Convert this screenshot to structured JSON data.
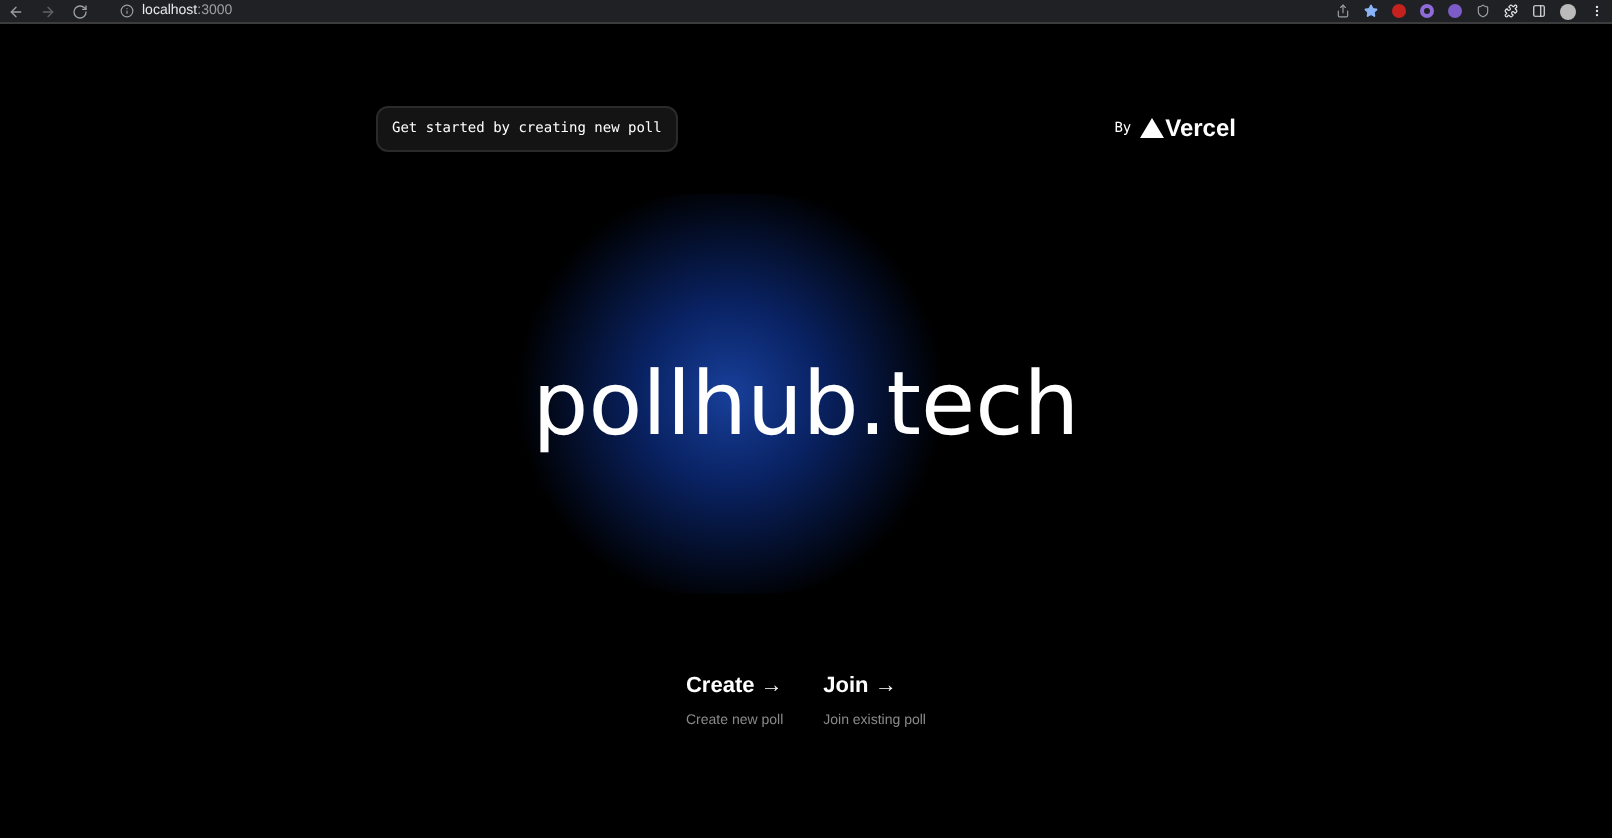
{
  "browser": {
    "host": "localhost",
    "port": ":3000"
  },
  "description": "Get started by creating new poll",
  "by": {
    "label": "By",
    "brand": "Vercel"
  },
  "title": "pollhub.tech",
  "cards": [
    {
      "title": "Create",
      "arrow": "→",
      "subtitle": "Create new poll"
    },
    {
      "title": "Join",
      "arrow": "→",
      "subtitle": "Join existing poll"
    }
  ]
}
